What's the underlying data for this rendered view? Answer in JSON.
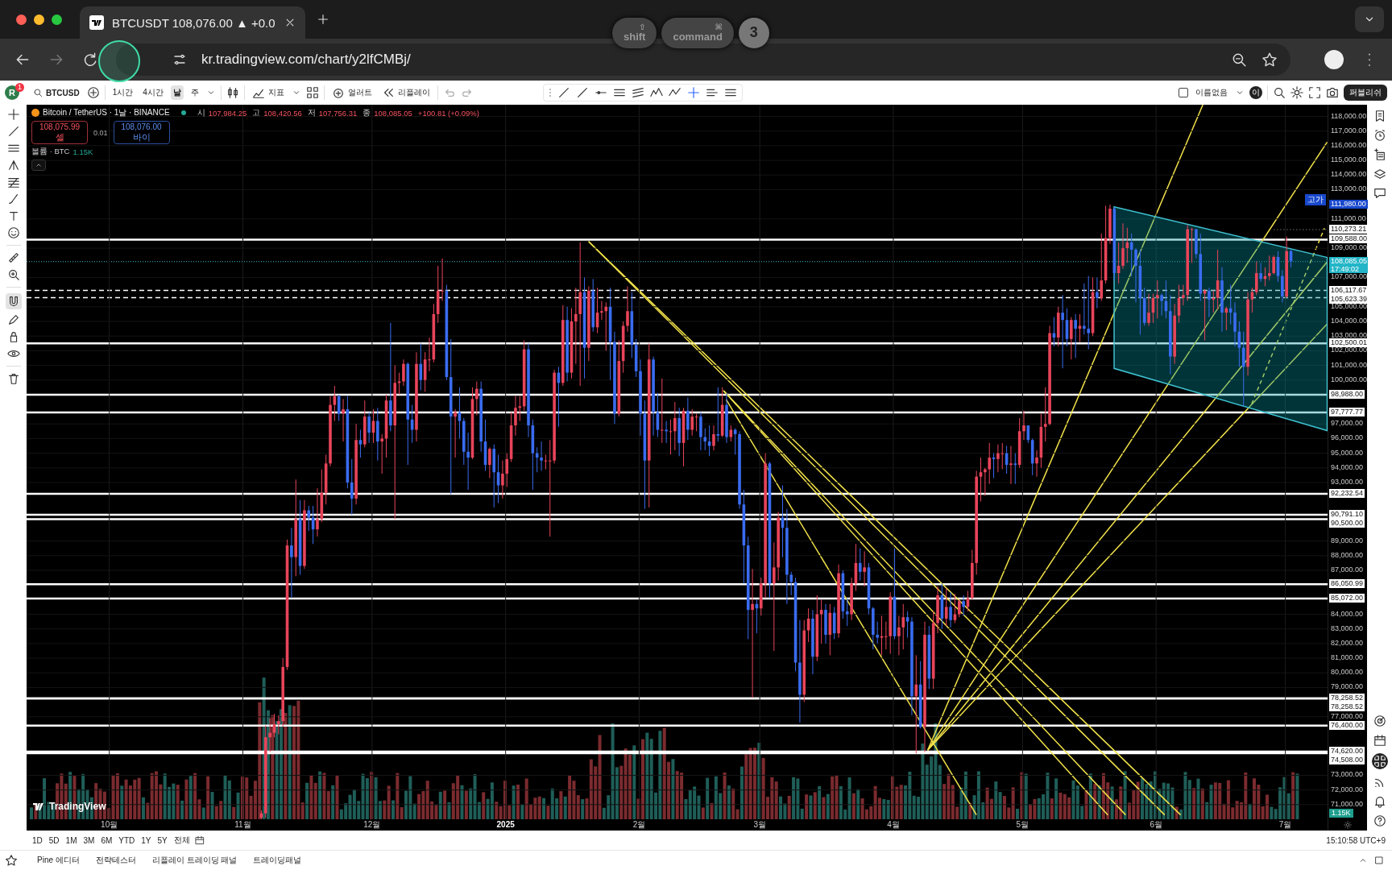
{
  "browser": {
    "tab": {
      "title": "BTCUSDT 108,076.00 ▲ +0.0"
    },
    "keystrokes": [
      {
        "symbol": "⇧",
        "label": "shift"
      },
      {
        "symbol": "⌘",
        "label": "command"
      },
      {
        "label": "3"
      }
    ],
    "address": "kr.tradingview.com/chart/y2lfCMBj/"
  },
  "toolbar": {
    "avatar": "R",
    "badge": "1",
    "symbol": "BTCUSD",
    "intervals": [
      {
        "label": "1시간",
        "selected": false
      },
      {
        "label": "4시간",
        "selected": false
      },
      {
        "label": "날",
        "selected": true
      },
      {
        "label": "주",
        "selected": false
      }
    ],
    "indicators": "지표",
    "alert": "얼러트",
    "replay": "리플레이",
    "checkbox": {
      "checked": false
    },
    "layout_name": "이름없음",
    "user_initial": "이",
    "publish": "퍼블리쉬"
  },
  "legend": {
    "title": "Bitcoin / TetherUS · 1날 · BINANCE",
    "ohlc": [
      {
        "key": "시",
        "value": "107,984.25"
      },
      {
        "key": "고",
        "value": "108,420.56"
      },
      {
        "key": "저",
        "value": "107,756.31"
      },
      {
        "key": "종",
        "value": "108,085.05"
      }
    ],
    "change": "+100.81 (+0.09%)",
    "sell": {
      "price": "108,075.99",
      "label": "셀"
    },
    "spread": "0.01",
    "buy": {
      "price": "108,076.00",
      "label": "바이"
    },
    "volume": {
      "title": "볼륨 · BTC",
      "value": "1.15K"
    }
  },
  "branding": "TradingView",
  "chart_data": {
    "type": "candlestick",
    "grid": true,
    "ylim": [
      70000,
      118800
    ],
    "yticks": [
      {
        "value": 118000,
        "label": "118,000.00"
      },
      {
        "value": 117000,
        "label": "117,000.00"
      },
      {
        "value": 116000,
        "label": "116,000.00"
      },
      {
        "value": 115000,
        "label": "115,000.00"
      },
      {
        "value": 114000,
        "label": "114,000.00"
      },
      {
        "value": 113000,
        "label": "113,000.00"
      },
      {
        "value": 111000,
        "label": "111,000.00"
      },
      {
        "value": 109000,
        "label": "109,000.00"
      },
      {
        "value": 107000,
        "label": "107,000.00"
      },
      {
        "value": 105000,
        "label": "105,000.00"
      },
      {
        "value": 104000,
        "label": "104,000.00"
      },
      {
        "value": 103000,
        "label": "103,000.00"
      },
      {
        "value": 102000,
        "label": "102,000.00"
      },
      {
        "value": 101000,
        "label": "101,000.00"
      },
      {
        "value": 100000,
        "label": "100,000.00"
      },
      {
        "value": 97000,
        "label": "97,000.00"
      },
      {
        "value": 96000,
        "label": "96,000.00"
      },
      {
        "value": 95000,
        "label": "95,000.00"
      },
      {
        "value": 94000,
        "label": "94,000.00"
      },
      {
        "value": 93000,
        "label": "93,000.00"
      },
      {
        "value": 89000,
        "label": "89,000.00"
      },
      {
        "value": 88000,
        "label": "88,000.00"
      },
      {
        "value": 87000,
        "label": "87,000.00"
      },
      {
        "value": 84000,
        "label": "84,000.00"
      },
      {
        "value": 83000,
        "label": "83,000.00"
      },
      {
        "value": 82000,
        "label": "82,000.00"
      },
      {
        "value": 81000,
        "label": "81,000.00"
      },
      {
        "value": 80000,
        "label": "80,000.00"
      },
      {
        "value": 79000,
        "label": "79,000.00"
      },
      {
        "value": 77000,
        "label": "77,000.00"
      },
      {
        "value": 73000,
        "label": "73,000.00"
      },
      {
        "value": 72000,
        "label": "72,000.00"
      },
      {
        "value": 71000,
        "label": "71,000.00"
      }
    ],
    "categories": [
      null,
      null,
      null,
      null,
      null,
      null,
      null,
      null,
      null,
      null,
      null,
      null,
      null,
      null,
      null,
      null,
      null,
      null,
      null,
      null,
      null,
      null,
      null,
      null,
      null,
      null,
      null,
      null,
      null,
      null,
      null,
      null,
      null,
      null,
      null,
      null,
      null,
      null,
      null,
      null,
      null,
      null,
      null,
      null,
      null,
      null,
      null,
      null,
      null,
      null,
      null,
      null,
      null,
      null,
      null,
      null,
      null,
      null,
      null,
      null,
      null,
      null,
      null,
      null,
      null,
      null,
      null,
      null,
      null,
      null,
      null,
      null,
      null,
      null,
      null,
      null,
      null,
      null,
      null,
      null,
      null,
      null,
      null,
      null,
      null,
      null,
      null,
      null,
      null,
      null,
      null,
      null,
      null,
      null,
      null,
      null,
      null,
      null,
      null,
      null,
      null,
      null,
      null,
      null,
      null,
      null,
      null,
      null,
      null,
      null,
      null,
      null,
      null,
      null,
      null,
      null,
      null,
      null,
      null,
      null,
      null,
      null,
      null,
      null,
      null,
      null,
      null,
      null,
      null,
      null,
      null,
      null,
      null,
      null,
      null,
      null,
      null,
      null,
      null,
      null,
      null,
      null,
      null,
      null,
      null,
      null,
      null,
      null,
      null,
      null,
      null,
      null,
      null,
      null,
      null,
      null,
      null,
      null,
      null,
      null,
      null,
      null,
      null,
      null,
      null,
      null,
      null,
      null,
      null,
      null,
      null,
      null,
      null,
      null,
      null,
      null,
      null,
      null,
      null,
      null,
      null,
      null,
      null,
      null,
      null,
      null,
      null,
      null,
      null,
      null,
      null,
      null,
      null,
      null,
      null,
      null,
      null,
      null,
      null,
      null,
      null,
      null,
      null,
      null,
      null,
      null,
      null,
      null,
      null,
      null,
      null,
      null,
      null,
      null,
      null,
      null,
      null,
      null,
      null,
      null,
      null,
      null,
      null,
      null,
      null,
      null,
      null,
      null,
      null,
      null,
      null,
      null,
      null,
      null,
      null,
      null,
      null,
      null,
      null,
      null,
      null,
      null,
      null,
      null,
      null,
      null,
      null,
      null,
      null,
      null,
      null,
      null,
      null,
      null,
      null,
      null,
      null,
      null,
      null,
      null,
      null,
      null,
      null,
      null,
      null,
      null,
      null,
      null,
      null,
      null,
      null,
      null,
      null,
      null,
      null,
      null,
      null,
      null,
      null,
      null,
      null,
      null,
      null,
      null,
      null,
      null,
      null,
      null,
      null,
      null,
      null,
      null,
      null,
      null,
      null,
      null,
      null,
      null,
      null,
      null,
      null,
      null
    ],
    "ohlc": [
      null,
      null,
      null,
      null,
      null,
      null,
      null,
      null,
      null,
      null,
      null,
      null,
      null,
      null,
      null,
      null,
      null,
      null,
      null,
      null,
      null,
      null,
      null,
      null,
      null,
      null,
      null,
      null,
      null,
      null,
      null,
      null,
      null,
      null,
      null,
      null,
      null,
      null,
      null,
      null,
      null,
      null,
      null,
      null,
      null,
      null,
      null,
      null,
      null,
      null,
      null,
      null,
      null,
      null,
      [
        70100,
        70600,
        70000,
        70400
      ],
      [
        70400,
        76400,
        70100,
        75600
      ],
      [
        75600,
        76900,
        74600,
        75900
      ],
      [
        75900,
        77200,
        75600,
        76500
      ],
      [
        76500,
        77100,
        75800,
        76700
      ],
      [
        76700,
        81000,
        76300,
        80400
      ],
      [
        80400,
        89100,
        80200,
        88700
      ],
      [
        88700,
        89900,
        85100,
        87900
      ],
      [
        87900,
        93200,
        86600,
        90500
      ],
      [
        90500,
        91800,
        86700,
        87300
      ],
      [
        87300,
        91800,
        87100,
        91100
      ],
      [
        91100,
        91400,
        89700,
        90600
      ],
      [
        90600,
        91400,
        88800,
        89800
      ],
      [
        89800,
        92600,
        89300,
        90500
      ],
      [
        90500,
        93900,
        90300,
        92300
      ],
      [
        92300,
        94900,
        91500,
        94300
      ],
      [
        94300,
        98900,
        94100,
        98300
      ],
      [
        98300,
        99600,
        97200,
        98900
      ],
      [
        98900,
        99000,
        97200,
        97700
      ],
      [
        97700,
        98700,
        95800,
        98000
      ],
      [
        98000,
        98900,
        92600,
        93000
      ],
      [
        93000,
        94600,
        90800,
        91900
      ],
      [
        91900,
        97000,
        91500,
        95900
      ],
      [
        95900,
        96600,
        94700,
        95600
      ],
      [
        95600,
        98600,
        95400,
        97500
      ],
      [
        97500,
        97800,
        95700,
        96400
      ],
      [
        96400,
        98000,
        95700,
        97200
      ],
      [
        97200,
        98100,
        94500,
        95800
      ],
      [
        95800,
        96300,
        93600,
        96000
      ],
      [
        96000,
        99000,
        94700,
        98600
      ],
      [
        98600,
        103900,
        96500,
        96900
      ],
      [
        96900,
        101000,
        90500,
        99800
      ],
      [
        99800,
        100500,
        99000,
        99900
      ],
      [
        99900,
        101400,
        99600,
        101100
      ],
      [
        101100,
        101200,
        94200,
        97300
      ],
      [
        97300,
        98300,
        95700,
        96600
      ],
      [
        96600,
        101900,
        95800,
        101100
      ],
      [
        101100,
        102500,
        99300,
        100000
      ],
      [
        100000,
        101900,
        99200,
        101400
      ],
      [
        101400,
        102900,
        100600,
        101400
      ],
      [
        101400,
        105200,
        101200,
        104500
      ],
      [
        104500,
        107800,
        103900,
        106100
      ],
      [
        106100,
        108300,
        105400,
        106100
      ],
      [
        106100,
        106500,
        100000,
        100200
      ],
      [
        100200,
        102800,
        92200,
        97500
      ],
      [
        97500,
        98000,
        94700,
        97800
      ],
      [
        97800,
        99500,
        96000,
        97200
      ],
      [
        97200,
        97400,
        94200,
        95100
      ],
      [
        95100,
        96400,
        92500,
        94700
      ],
      [
        94700,
        99500,
        94600,
        98700
      ],
      [
        98700,
        99900,
        97600,
        99400
      ],
      [
        99400,
        99900,
        95100,
        95800
      ],
      [
        95800,
        97300,
        93800,
        94200
      ],
      [
        94200,
        95400,
        93300,
        95300
      ],
      [
        95300,
        95600,
        91300,
        93700
      ],
      [
        93700,
        94900,
        91600,
        92800
      ],
      [
        92800,
        94500,
        91900,
        93600
      ],
      [
        93600,
        95000,
        92700,
        94600
      ],
      [
        94600,
        97800,
        94400,
        96900
      ],
      [
        96900,
        98900,
        96200,
        98100
      ],
      [
        98100,
        98900,
        97200,
        98200
      ],
      [
        98200,
        102700,
        97900,
        102100
      ],
      [
        102100,
        102500,
        96100,
        96900
      ],
      [
        96900,
        97300,
        92500,
        95000
      ],
      [
        95000,
        95400,
        93700,
        94700
      ],
      [
        94700,
        95800,
        93800,
        94500
      ],
      [
        94500,
        94900,
        93900,
        94500
      ],
      [
        94500,
        95900,
        89300,
        94500
      ],
      [
        94500,
        100700,
        94300,
        100500
      ],
      [
        100500,
        100900,
        96800,
        99800
      ],
      [
        99800,
        105100,
        99600,
        104100
      ],
      [
        104100,
        105000,
        99900,
        100500
      ],
      [
        100500,
        104900,
        100100,
        104000
      ],
      [
        104000,
        106300,
        101100,
        104500
      ],
      [
        104500,
        109400,
        99600,
        106000
      ],
      [
        106000,
        107000,
        100100,
        102200
      ],
      [
        102200,
        106400,
        101300,
        106100
      ],
      [
        106100,
        106900,
        103300,
        103600
      ],
      [
        103600,
        106300,
        103200,
        104600
      ],
      [
        104600,
        105400,
        104100,
        104700
      ],
      [
        104700,
        105300,
        102000,
        105000
      ],
      [
        105000,
        106300,
        100000,
        102600
      ],
      [
        102600,
        103300,
        97000,
        97700
      ],
      [
        97700,
        102700,
        97500,
        101300
      ],
      [
        101300,
        104000,
        100500,
        103700
      ],
      [
        103700,
        106400,
        103300,
        104700
      ],
      [
        104700,
        106000,
        101500,
        102400
      ],
      [
        102400,
        102800,
        100200,
        100600
      ],
      [
        100600,
        101400,
        96200,
        97700
      ],
      [
        97700,
        98600,
        91200,
        94500
      ],
      [
        94500,
        102500,
        91300,
        101400
      ],
      [
        101400,
        101600,
        96200,
        97800
      ],
      [
        97800,
        99100,
        96100,
        96600
      ],
      [
        96600,
        100100,
        95700,
        96600
      ],
      [
        96600,
        97200,
        95700,
        96500
      ],
      [
        96500,
        97300,
        94900,
        96500
      ],
      [
        96500,
        98500,
        95200,
        97400
      ],
      [
        97400,
        98100,
        94800,
        95700
      ],
      [
        95700,
        98100,
        94100,
        97900
      ],
      [
        97900,
        98800,
        95900,
        96600
      ],
      [
        96600,
        98000,
        96200,
        97500
      ],
      [
        97500,
        97700,
        96500,
        97500
      ],
      [
        97500,
        97800,
        95200,
        96100
      ],
      [
        96100,
        96700,
        95200,
        95800
      ],
      [
        95800,
        96900,
        94800,
        95500
      ],
      [
        95500,
        96900,
        95200,
        96300
      ],
      [
        96300,
        99500,
        95800,
        96200
      ],
      [
        96200,
        99500,
        96100,
        98300
      ],
      [
        98300,
        99100,
        95700,
        96100
      ],
      [
        96100,
        96900,
        95800,
        96600
      ],
      [
        96600,
        96700,
        94900,
        96300
      ],
      [
        96300,
        96500,
        91200,
        91500
      ],
      [
        91500,
        92500,
        86100,
        88700
      ],
      [
        88700,
        89300,
        82300,
        84300
      ],
      [
        84300,
        87100,
        78300,
        84700
      ],
      [
        84700,
        85000,
        82700,
        84400
      ],
      [
        84400,
        86500,
        83900,
        86100
      ],
      [
        86100,
        95000,
        85100,
        94300
      ],
      [
        94300,
        94400,
        85100,
        86100
      ],
      [
        86100,
        88900,
        81500,
        87200
      ],
      [
        87200,
        91000,
        86300,
        90600
      ],
      [
        90600,
        92800,
        87900,
        89900
      ],
      [
        89900,
        91200,
        84700,
        86700
      ],
      [
        86700,
        86900,
        85300,
        86200
      ],
      [
        86200,
        86500,
        80100,
        80700
      ],
      [
        80700,
        83600,
        76600,
        78500
      ],
      [
        78500,
        83600,
        78000,
        82900
      ],
      [
        82900,
        84400,
        82100,
        83700
      ],
      [
        83700,
        84300,
        79900,
        81100
      ],
      [
        81100,
        85300,
        80800,
        84000
      ],
      [
        84000,
        85000,
        82000,
        84300
      ],
      [
        84300,
        84700,
        82000,
        82600
      ],
      [
        82600,
        84700,
        81200,
        84100
      ],
      [
        84100,
        84500,
        82300,
        82700
      ],
      [
        82700,
        87400,
        82400,
        86800
      ],
      [
        86800,
        87000,
        83700,
        84200
      ],
      [
        84200,
        85100,
        83200,
        84000
      ],
      [
        84000,
        86500,
        83600,
        86100
      ],
      [
        86100,
        88800,
        85600,
        87500
      ],
      [
        87500,
        88500,
        86300,
        86900
      ],
      [
        86900,
        88300,
        85900,
        87200
      ],
      [
        87200,
        87500,
        84000,
        84400
      ],
      [
        84400,
        84500,
        81600,
        82600
      ],
      [
        82600,
        83500,
        82000,
        82400
      ],
      [
        82400,
        83900,
        81200,
        82500
      ],
      [
        82500,
        83500,
        81600,
        82500
      ],
      [
        82500,
        85500,
        81300,
        85200
      ],
      [
        85200,
        88500,
        82300,
        82500
      ],
      [
        82500,
        83900,
        81200,
        83100
      ],
      [
        83100,
        84700,
        81600,
        83800
      ],
      [
        83800,
        84200,
        82400,
        83500
      ],
      [
        83500,
        83800,
        77100,
        78400
      ],
      [
        78400,
        81200,
        74500,
        79200
      ],
      [
        79200,
        80800,
        76200,
        76300
      ],
      [
        76300,
        83500,
        74600,
        82600
      ],
      [
        82600,
        83200,
        78900,
        79600
      ],
      [
        79600,
        84200,
        78900,
        83400
      ],
      [
        83400,
        85900,
        82700,
        85300
      ],
      [
        85300,
        86100,
        83000,
        83700
      ],
      [
        83700,
        85800,
        83200,
        84500
      ],
      [
        84500,
        85500,
        83100,
        83600
      ],
      [
        83600,
        85400,
        83400,
        84000
      ],
      [
        84000,
        85000,
        83800,
        84900
      ],
      [
        84900,
        85300,
        83900,
        84500
      ],
      [
        84500,
        85600,
        84200,
        85100
      ],
      [
        85100,
        88400,
        85000,
        87500
      ],
      [
        87500,
        93800,
        86700,
        93400
      ],
      [
        93400,
        94700,
        91700,
        93700
      ],
      [
        93700,
        94000,
        92100,
        93900
      ],
      [
        93900,
        95700,
        92900,
        94700
      ],
      [
        94700,
        95000,
        93300,
        94600
      ],
      [
        94600,
        95600,
        93700,
        95000
      ],
      [
        95000,
        95700,
        93900,
        95000
      ],
      [
        95000,
        95500,
        93600,
        94200
      ],
      [
        94200,
        95500,
        92900,
        94300
      ],
      [
        94300,
        95000,
        92900,
        94200
      ],
      [
        94200,
        97400,
        94000,
        96500
      ],
      [
        96500,
        97900,
        95900,
        96900
      ],
      [
        96900,
        96900,
        95700,
        95900
      ],
      [
        95900,
        96000,
        93500,
        94300
      ],
      [
        94300,
        95200,
        93400,
        94700
      ],
      [
        94700,
        97700,
        94000,
        96800
      ],
      [
        96800,
        99500,
        95800,
        97000
      ],
      [
        97000,
        103700,
        96900,
        103200
      ],
      [
        103200,
        104300,
        102300,
        102900
      ],
      [
        102900,
        105000,
        102300,
        104600
      ],
      [
        104600,
        105800,
        100800,
        104100
      ],
      [
        104100,
        104900,
        102300,
        102800
      ],
      [
        102800,
        104300,
        101400,
        104100
      ],
      [
        104100,
        104500,
        101500,
        103500
      ],
      [
        103500,
        104500,
        102600,
        103700
      ],
      [
        103700,
        106600,
        103100,
        103500
      ],
      [
        103500,
        107100,
        102100,
        103200
      ],
      [
        103200,
        107000,
        103000,
        106000
      ],
      [
        106000,
        107000,
        104900,
        105600
      ],
      [
        105600,
        110000,
        105400,
        106800
      ],
      [
        106800,
        111900,
        106600,
        109700
      ],
      [
        109700,
        111980,
        109300,
        111700
      ],
      [
        111700,
        111800,
        106800,
        107300
      ],
      [
        107300,
        109400,
        106600,
        107800
      ],
      [
        107800,
        110700,
        107600,
        109000
      ],
      [
        109000,
        110400,
        108000,
        109400
      ],
      [
        109400,
        110000,
        107100,
        108900
      ],
      [
        108900,
        109000,
        105300,
        107800
      ],
      [
        107800,
        108900,
        103100,
        105600
      ],
      [
        105600,
        106300,
        103700,
        103900
      ],
      [
        103900,
        105900,
        103700,
        104600
      ],
      [
        104600,
        105900,
        103900,
        105600
      ],
      [
        105600,
        106800,
        104200,
        105800
      ],
      [
        105800,
        105900,
        104400,
        105400
      ],
      [
        105400,
        106800,
        104200,
        104700
      ],
      [
        104700,
        105800,
        100400,
        101600
      ],
      [
        101600,
        105200,
        101100,
        104400
      ],
      [
        104400,
        106500,
        103900,
        105600
      ],
      [
        105600,
        106500,
        105100,
        105800
      ],
      [
        105800,
        110600,
        105400,
        110300
      ],
      [
        110300,
        110400,
        108000,
        110300
      ],
      [
        110300,
        110300,
        108300,
        108600
      ],
      [
        108600,
        110000,
        105400,
        105900
      ],
      [
        105900,
        106200,
        102700,
        106100
      ],
      [
        106100,
        106300,
        104300,
        105500
      ],
      [
        105500,
        106100,
        104600,
        105600
      ],
      [
        105600,
        108900,
        104800,
        106800
      ],
      [
        106800,
        107700,
        103300,
        104600
      ],
      [
        104600,
        105000,
        103400,
        104900
      ],
      [
        104900,
        106500,
        103800,
        104600
      ],
      [
        104600,
        105300,
        102300,
        103300
      ],
      [
        103300,
        104000,
        100900,
        102200
      ],
      [
        102200,
        103300,
        98200,
        100900
      ],
      [
        100900,
        106000,
        100300,
        105500
      ],
      [
        105500,
        106300,
        104600,
        106000
      ],
      [
        106000,
        108100,
        105800,
        107300
      ],
      [
        107300,
        108000,
        106700,
        106900
      ],
      [
        106900,
        107700,
        106400,
        107100
      ],
      [
        107100,
        108500,
        106800,
        107300
      ],
      [
        107300,
        108500,
        107200,
        108400
      ],
      [
        108400,
        108800,
        106700,
        107100
      ],
      [
        107100,
        107500,
        105300,
        105700
      ],
      [
        105700,
        109800,
        105600,
        108800
      ],
      [
        108800,
        108900,
        107700,
        108100
      ],
      null,
      null,
      null,
      null,
      null,
      null,
      null,
      null
    ]
  },
  "price_axis": {
    "high": {
      "tag": "고가",
      "price": "111,980.00"
    },
    "last": {
      "price": "108,085.05",
      "countdown": "17:49:02"
    },
    "levels": [
      {
        "label": "110,273.21",
        "kind": "dotted"
      },
      {
        "label": "109,588.00",
        "kind": "solid"
      },
      {
        "label": "106,117.67",
        "kind": "dashed"
      },
      {
        "label": "105,623.39",
        "kind": "dashed"
      },
      {
        "label": "102,500.01",
        "kind": "solid"
      },
      {
        "label": "98,988.00",
        "kind": "solid"
      },
      {
        "label": "97,777.77",
        "kind": "solid"
      },
      {
        "label": "92,232.54",
        "kind": "solid"
      },
      {
        "label": "90,791.10",
        "kind": "solid"
      },
      {
        "label": "90,500.00",
        "kind": "solid"
      },
      {
        "label": "86,050.99",
        "kind": "solid"
      },
      {
        "label": "85,072.00",
        "kind": "solid"
      },
      {
        "label": "78,258.52",
        "kind": "solid"
      },
      {
        "label": "78,258.52",
        "kind": "solid"
      },
      {
        "label": "76,400.00",
        "kind": "solid"
      },
      {
        "label": "74,620.00",
        "kind": "solid"
      },
      {
        "label": "74,508.00",
        "kind": "solid"
      }
    ],
    "volume_tag": "1.15K"
  },
  "time_axis": [
    {
      "label": "10월",
      "kind": "month"
    },
    {
      "label": "11월",
      "kind": "month"
    },
    {
      "label": "12월",
      "kind": "month"
    },
    {
      "label": "2025",
      "kind": "year"
    },
    {
      "label": "2월",
      "kind": "month"
    },
    {
      "label": "3월",
      "kind": "month"
    },
    {
      "label": "4월",
      "kind": "month"
    },
    {
      "label": "5월",
      "kind": "month"
    },
    {
      "label": "6월",
      "kind": "month"
    },
    {
      "label": "7월",
      "kind": "month"
    }
  ],
  "range_bar": {
    "ranges": [
      "1D",
      "5D",
      "1M",
      "3M",
      "6M",
      "YTD",
      "1Y",
      "5Y",
      "전체"
    ],
    "clock": "15:10:58 UTC+9"
  },
  "bottom_panel": {
    "tabs": [
      "Pine 에디터",
      "전략테스터",
      "리플레이 트레이딩 패널",
      "트레이딩패널"
    ]
  }
}
